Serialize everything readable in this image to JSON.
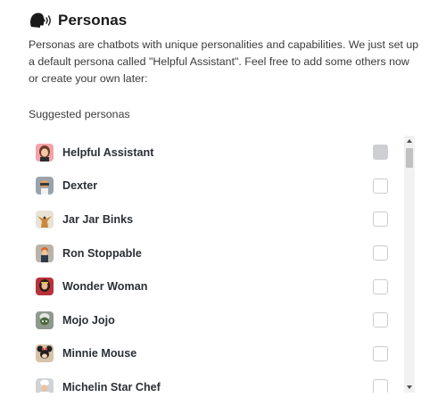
{
  "header": {
    "icon": "speaking-head-icon",
    "title": "Personas"
  },
  "description": "Personas are chatbots with unique personalities and capabilities. We just set up a default persona called \"Helpful Assistant\". Feel free to add some others now or create your own later:",
  "suggested_label": "Suggested personas",
  "personas": [
    {
      "name": "Helpful Assistant",
      "checked": true,
      "avatar": "woman-avatar-icon",
      "avatar_bg": "#f2a3a8"
    },
    {
      "name": "Dexter",
      "checked": false,
      "avatar": "boy-with-glasses-avatar-icon",
      "avatar_bg": "#9aa3ad"
    },
    {
      "name": "Jar Jar Binks",
      "checked": false,
      "avatar": "alien-creature-avatar-icon",
      "avatar_bg": "#e9e3d6"
    },
    {
      "name": "Ron Stoppable",
      "checked": false,
      "avatar": "redhead-boy-avatar-icon",
      "avatar_bg": "#b9b3aa"
    },
    {
      "name": "Wonder Woman",
      "checked": false,
      "avatar": "heroine-avatar-icon",
      "avatar_bg": "#b8323a"
    },
    {
      "name": "Mojo Jojo",
      "checked": false,
      "avatar": "monkey-avatar-icon",
      "avatar_bg": "#8f9a8e"
    },
    {
      "name": "Minnie Mouse",
      "checked": false,
      "avatar": "mouse-avatar-icon",
      "avatar_bg": "#d7c3a7"
    },
    {
      "name": "Michelin Star Chef",
      "checked": false,
      "avatar": "chef-avatar-icon",
      "avatar_bg": "#cfd3d8"
    }
  ],
  "scrollbar": {
    "up_icon": "scroll-up-arrow-icon",
    "down_icon": "scroll-down-arrow-icon"
  }
}
